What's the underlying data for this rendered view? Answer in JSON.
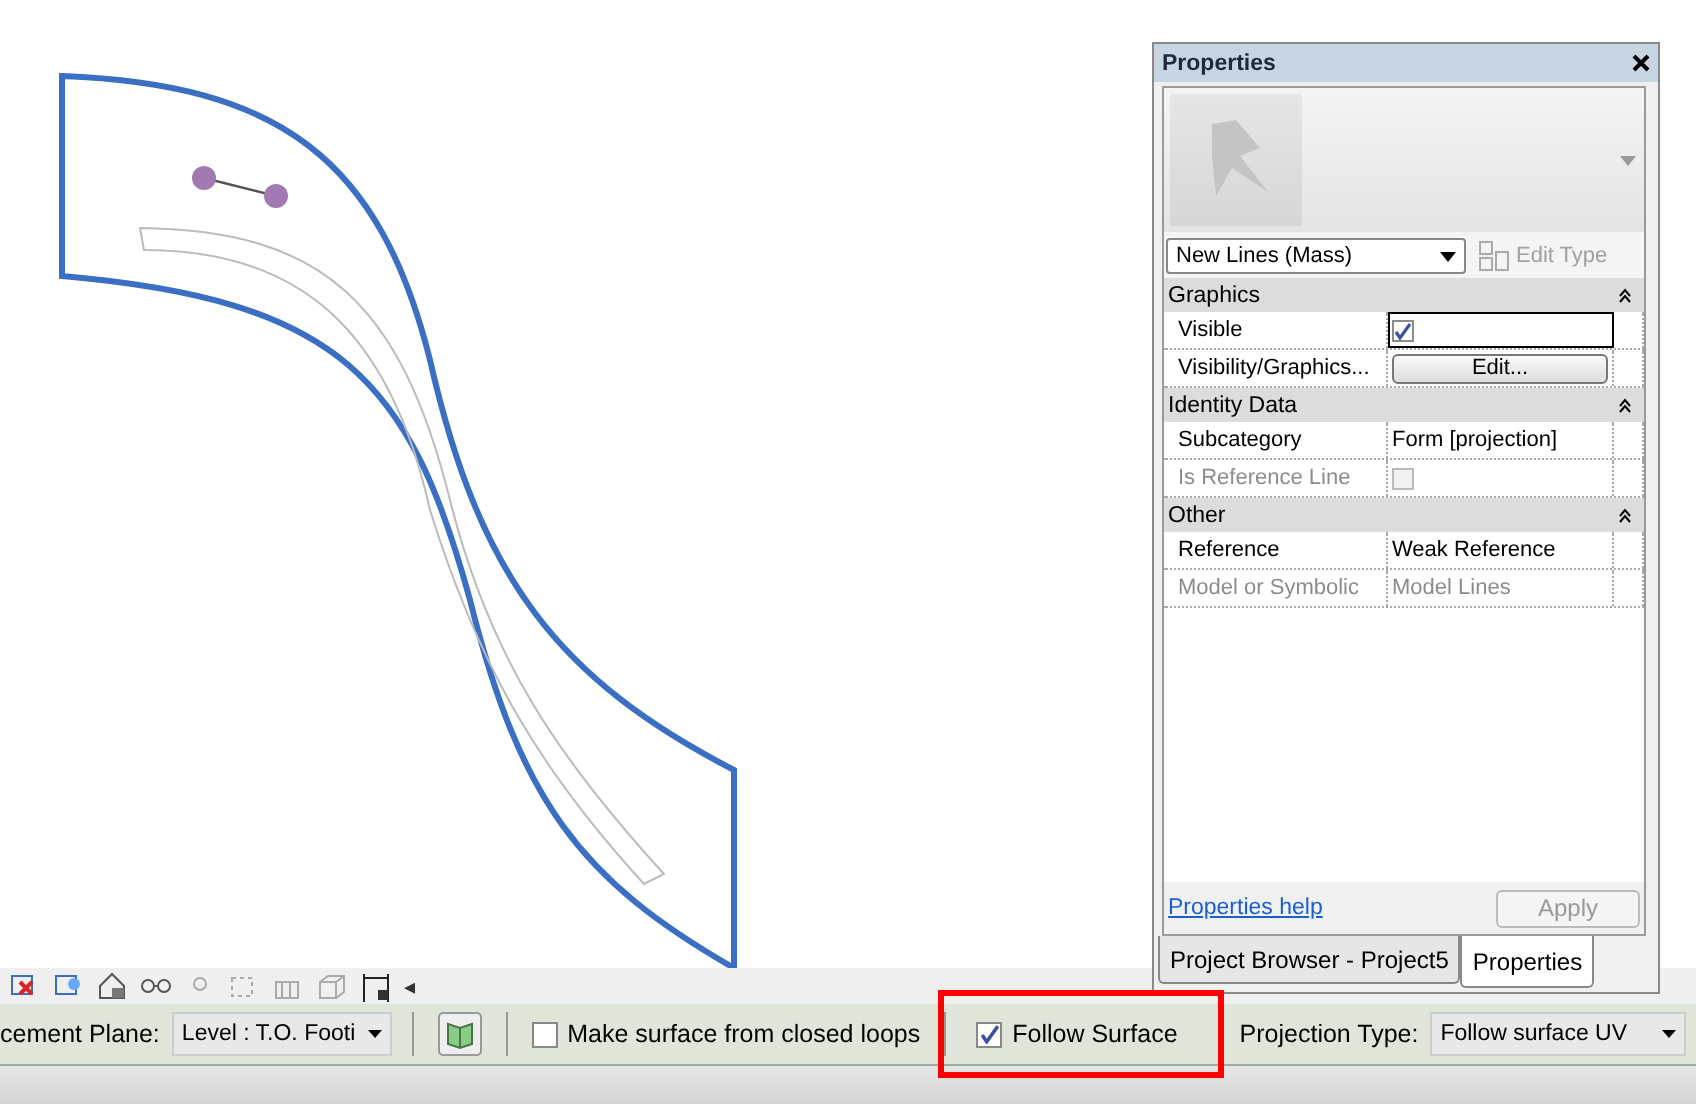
{
  "properties_panel": {
    "title": "Properties",
    "type_selector": "New Lines (Mass)",
    "edit_type": {
      "label": "Edit Type",
      "disabled": true
    },
    "groups": [
      {
        "name": "Graphics",
        "expanded": true,
        "rows": [
          {
            "label": "Visible",
            "kind": "checkbox",
            "checked": true,
            "disabled": false
          },
          {
            "label": "Visibility/Graphics...",
            "kind": "button",
            "value": "Edit...",
            "disabled": false
          }
        ]
      },
      {
        "name": "Identity Data",
        "expanded": true,
        "rows": [
          {
            "label": "Subcategory",
            "kind": "text",
            "value": "Form [projection]",
            "disabled": false
          },
          {
            "label": "Is Reference Line",
            "kind": "checkbox",
            "checked": false,
            "disabled": true
          }
        ]
      },
      {
        "name": "Other",
        "expanded": true,
        "rows": [
          {
            "label": "Reference",
            "kind": "text",
            "value": "Weak Reference",
            "disabled": false
          },
          {
            "label": "Model or Symbolic",
            "kind": "text",
            "value": "Model Lines",
            "disabled": true
          }
        ]
      }
    ],
    "help_link": "Properties help",
    "apply": {
      "label": "Apply",
      "disabled": true
    },
    "tabs": [
      {
        "label": "Project Browser - Project5",
        "selected": false
      },
      {
        "label": "Properties",
        "selected": true
      }
    ]
  },
  "toolbar": {
    "scroll_arrow": "◂"
  },
  "options_bar": {
    "placement_label": "cement Plane:",
    "placement_value": "Level : T.O. Footi",
    "make_surface": {
      "label": "Make surface from closed loops",
      "checked": false
    },
    "follow_surface": {
      "label": "Follow Surface",
      "checked": true,
      "highlighted": true
    },
    "projection_label": "Projection Type:",
    "projection_value": "Follow surface UV"
  }
}
